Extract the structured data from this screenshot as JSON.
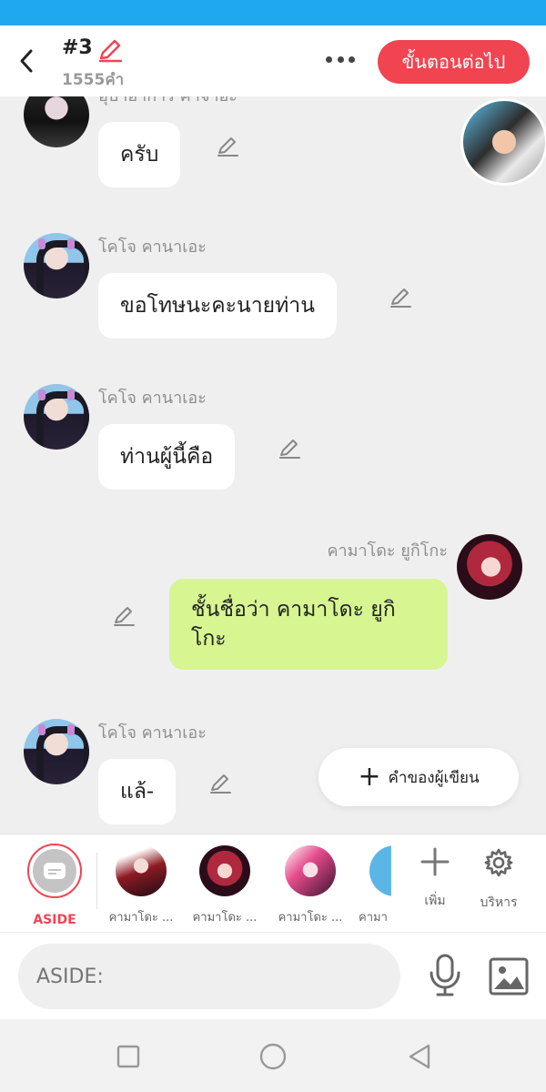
{
  "header": {
    "episode": "#3",
    "word_count": "1555คำ",
    "next_label": "ขั้นตอนต่อไป"
  },
  "messages": [
    {
      "name": "อุบาอาการ คาจาอะ",
      "text": "ครับ"
    },
    {
      "name": "โคโจ คานาเอะ",
      "text": "ขอโทษนะคะนายท่าน"
    },
    {
      "name": "โคโจ คานาเอะ",
      "text": "ท่านผู้นี้คือ"
    },
    {
      "name": "คามาโดะ ยูกิโกะ",
      "text": "ชั้นชื่อว่า คามาโดะ ยูกิโกะ"
    },
    {
      "name": "โคโจ คานาเอะ",
      "text": "แล้-"
    }
  ],
  "author_button": "คำของผู้เขียน",
  "charbar": {
    "aside_label": "ASIDE",
    "characters": [
      "คามาโดะ ...",
      "คามาโดะ ...",
      "คามาโดะ ...",
      "คามา"
    ],
    "add_label": "เพิ่ม",
    "manage_label": "บริหาร"
  },
  "input": {
    "placeholder": "ASIDE:"
  },
  "colors": {
    "accent": "#f04451",
    "statusbar": "#1fa8ee",
    "my_bubble": "#d7f591"
  }
}
